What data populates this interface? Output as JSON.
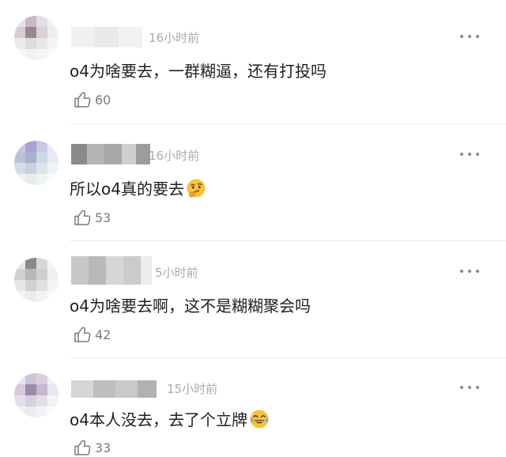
{
  "comments": [
    {
      "time": "16小时前",
      "text": "o4为啥要去，一群糊逼，还有打投吗",
      "likes": "60",
      "emoji": ""
    },
    {
      "time": "16小时前",
      "text": "所以o4真的要去",
      "likes": "53",
      "emoji": "thinking-face-emoji"
    },
    {
      "time": "5小时前",
      "text": "o4为啥要去啊，这不是糊糊聚会吗",
      "likes": "42",
      "emoji": ""
    },
    {
      "time": "15小时前",
      "text": "o4本人没去，去了个立牌",
      "likes": "33",
      "emoji": "tears-of-joy-emoji"
    }
  ],
  "icons": {
    "more": "more-dots-icon",
    "like": "thumbs-up-icon"
  },
  "colors": {
    "text": "#1e1e1e",
    "time": "#a9a9a9",
    "like_count": "#7a7a7a",
    "emoji_face": "#f7c23a"
  }
}
